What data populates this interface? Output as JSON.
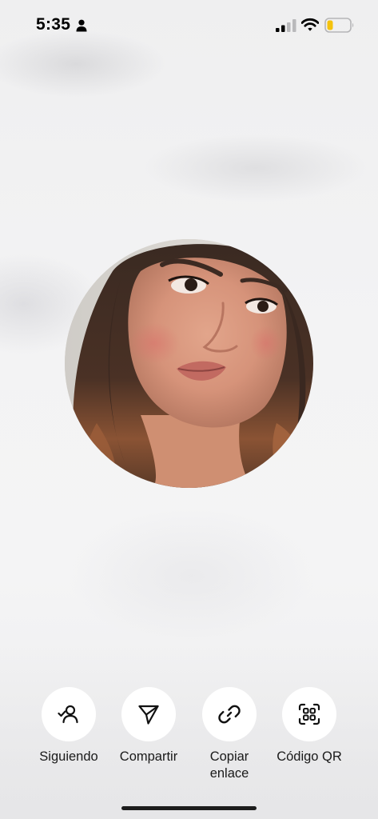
{
  "status_bar": {
    "time": "5:35",
    "icons": [
      "person-icon",
      "cellular-signal-icon",
      "wifi-icon",
      "battery-low-icon"
    ],
    "battery_color": "#f4c20d"
  },
  "profile": {
    "avatar": "profile-photo"
  },
  "actions": [
    {
      "label": "Siguiendo",
      "icon": "following-person-check-icon"
    },
    {
      "label": "Compartir",
      "icon": "share-send-icon"
    },
    {
      "label": "Copiar\nenlace",
      "icon": "link-icon"
    },
    {
      "label": "Código QR",
      "icon": "qr-code-scan-icon"
    }
  ],
  "colors": {
    "background": "#f1f1f2",
    "button_background": "#ffffff",
    "text": "#1a1a1a"
  }
}
